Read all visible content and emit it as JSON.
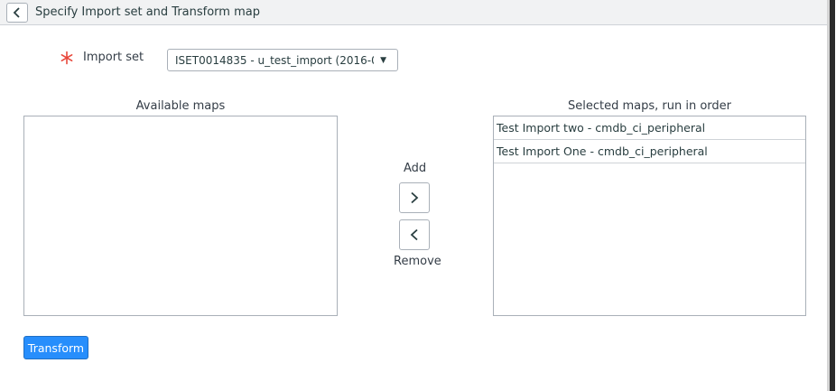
{
  "header": {
    "title": "Specify Import set and Transform map"
  },
  "import_set": {
    "label": "Import set",
    "selected_value": "ISET0014835 - u_test_import (2016-0..."
  },
  "available_maps": {
    "label": "Available maps",
    "items": []
  },
  "selected_maps": {
    "label": "Selected maps, run in order",
    "items": [
      "Test Import two - cmdb_ci_peripheral",
      "Test Import One - cmdb_ci_peripheral"
    ]
  },
  "controls": {
    "add_label": "Add",
    "remove_label": "Remove"
  },
  "actions": {
    "transform_label": "Transform"
  },
  "colors": {
    "primary_button": "#278efc",
    "required_star": "#e8473b",
    "header_bg": "#f1f2f3"
  }
}
